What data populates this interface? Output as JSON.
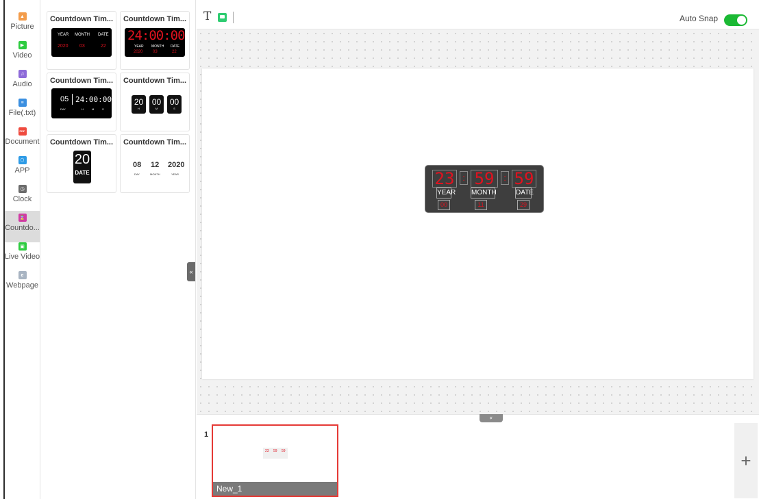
{
  "sidebar": {
    "items": [
      {
        "label": "Picture",
        "icon": "picture-icon",
        "color": "#f39c4b",
        "glyph": "▲"
      },
      {
        "label": "Video",
        "icon": "video-icon",
        "color": "#2ecc40",
        "glyph": "▶"
      },
      {
        "label": "Audio",
        "icon": "audio-icon",
        "color": "#8e6bd9",
        "glyph": "♫"
      },
      {
        "label": "File(.txt)",
        "icon": "file-icon",
        "color": "#3b8fe0",
        "glyph": "≡"
      },
      {
        "label": "Document",
        "icon": "pdf-icon",
        "color": "#ef4b3f",
        "glyph": "PDF"
      },
      {
        "label": "APP",
        "icon": "app-icon",
        "color": "#2e9be6",
        "glyph": "⬡"
      },
      {
        "label": "Clock",
        "icon": "clock-icon",
        "color": "#6b6b6b",
        "glyph": "◷"
      },
      {
        "label": "Countdo...",
        "icon": "countdown-icon",
        "color": "#d13ba5",
        "glyph": "⌛",
        "active": true
      },
      {
        "label": "Live Video",
        "icon": "live-video-icon",
        "color": "#2ecc40",
        "glyph": "▣"
      },
      {
        "label": "Webpage",
        "icon": "webpage-icon",
        "color": "#a8b4c2",
        "glyph": "e"
      }
    ]
  },
  "templates": {
    "cards": [
      {
        "title": "Countdown Tim...",
        "labels": [
          "YEAR",
          "MONTH",
          "DATE"
        ],
        "values": [
          "2020",
          "03",
          "22"
        ]
      },
      {
        "title": "Countdown Tim...",
        "time": "24:00:00",
        "labels": [
          "YEAR",
          "MONTH",
          "DATE"
        ],
        "values": [
          "2020",
          "03",
          "22"
        ]
      },
      {
        "title": "Countdown Tim...",
        "day": "05",
        "time": "24:00:00",
        "sub": [
          "DAY",
          "H",
          "M",
          "S"
        ]
      },
      {
        "title": "Countdown Tim...",
        "digits": [
          "20",
          "00",
          "00"
        ],
        "sub": [
          "H",
          "M",
          "S"
        ]
      },
      {
        "title": "Countdown Tim...",
        "number": "20",
        "caption": "DATE"
      },
      {
        "title": "Countdown Tim...",
        "numbers": [
          "08",
          "12",
          "2020"
        ],
        "sub": [
          "DAY",
          "MONTH",
          "YEAR"
        ]
      }
    ],
    "collapse_glyph": "«"
  },
  "toolbar": {
    "text_tool": "T",
    "auto_snap_label": "Auto Snap",
    "auto_snap_on": true
  },
  "widget": {
    "digits": [
      "23",
      "59",
      "59"
    ],
    "separator": ":",
    "labels": [
      "YEAR",
      "MONTH",
      "DATE"
    ],
    "values": [
      "00",
      "11",
      "29"
    ]
  },
  "strip": {
    "expand_glyph": "»",
    "number": "1",
    "slide_name": "New_1",
    "mini_digits": [
      "23",
      "59",
      "59"
    ],
    "add_glyph": "+"
  }
}
